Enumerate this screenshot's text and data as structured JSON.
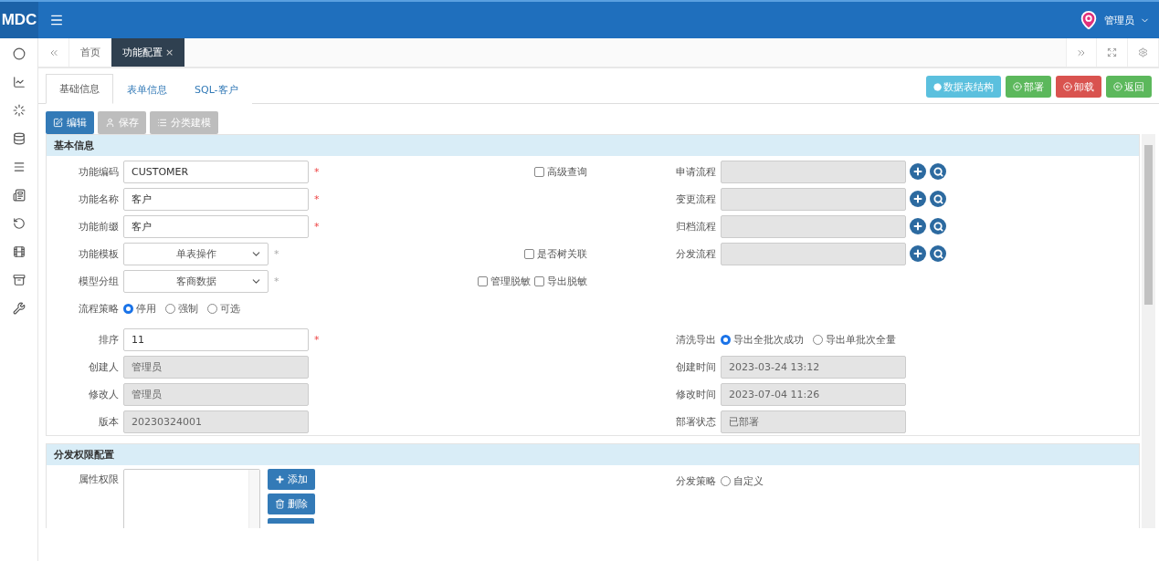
{
  "header": {
    "logo": "MDC",
    "user": "管理员"
  },
  "page_tabs": [
    {
      "label": "首页",
      "selected": false,
      "closable": false
    },
    {
      "label": "功能配置",
      "selected": true,
      "closable": true
    }
  ],
  "close_mark": "×",
  "sub_tabs": [
    {
      "label": "基础信息",
      "selected": true
    },
    {
      "label": "表单信息",
      "selected": false
    },
    {
      "label": "SQL-客户",
      "selected": false
    }
  ],
  "actions": [
    {
      "label": "数据表结构",
      "color": "#5bc0de"
    },
    {
      "label": "部署",
      "color": "#5cb85c"
    },
    {
      "label": "卸载",
      "color": "#d9534f"
    },
    {
      "label": "返回",
      "color": "#5cb85c"
    }
  ],
  "toolbar": [
    {
      "label": "编辑",
      "disabled": false
    },
    {
      "label": "保存",
      "disabled": true
    },
    {
      "label": "分类建模",
      "disabled": true
    }
  ],
  "basic_section": {
    "title": "基本信息",
    "rows": [
      {
        "left": {
          "label": "功能编码",
          "kind": "text",
          "value": "CUSTOMER",
          "required": true,
          "disabled": false
        },
        "checks": [
          {
            "label": "高级查询",
            "checked": false
          }
        ],
        "right": {
          "label": "申请流程",
          "kind": "lookup",
          "disabled": true
        }
      },
      {
        "left": {
          "label": "功能名称",
          "kind": "text",
          "value": "客户",
          "required": true,
          "disabled": false
        },
        "checks": [],
        "right": {
          "label": "变更流程",
          "kind": "lookup",
          "disabled": true
        }
      },
      {
        "left": {
          "label": "功能前缀",
          "kind": "text",
          "value": "客户",
          "required": true,
          "disabled": false
        },
        "checks": [],
        "right": {
          "label": "归档流程",
          "kind": "lookup",
          "disabled": true
        }
      },
      {
        "left": {
          "label": "功能模板",
          "kind": "select",
          "value": "单表操作",
          "required": true,
          "disabled": false
        },
        "checks": [
          {
            "label": "是否树关联",
            "checked": false
          }
        ],
        "right": {
          "label": "分发流程",
          "kind": "lookup",
          "disabled": true
        }
      },
      {
        "left": {
          "label": "模型分组",
          "kind": "select",
          "value": "客商数据",
          "required": true,
          "disabled": false
        },
        "checks": [
          {
            "label": "管理脱敏",
            "checked": false
          },
          {
            "label": "导出脱敏",
            "checked": false
          }
        ]
      },
      {
        "left": {
          "label": "流程策略",
          "kind": "radio",
          "options": [
            {
              "label": "停用",
              "selected": true
            },
            {
              "label": "强制",
              "selected": false
            },
            {
              "label": "可选",
              "selected": false
            }
          ]
        },
        "checks": []
      },
      {
        "left": {
          "label": "排序",
          "kind": "text",
          "value": "11",
          "required": true,
          "disabled": false
        },
        "checks": [],
        "right": {
          "label": "清洗导出",
          "kind": "radio",
          "options": [
            {
              "label": "导出全批次成功",
              "selected": true
            },
            {
              "label": "导出单批次全量",
              "selected": false
            }
          ]
        }
      },
      {
        "left": {
          "label": "创建人",
          "kind": "text",
          "value": "管理员",
          "required": false,
          "disabled": true
        },
        "checks": [],
        "right": {
          "label": "创建时间",
          "kind": "text",
          "value": "2023-03-24 13:12",
          "required": false,
          "disabled": true
        }
      },
      {
        "left": {
          "label": "修改人",
          "kind": "text",
          "value": "管理员",
          "required": false,
          "disabled": true
        },
        "checks": [],
        "right": {
          "label": "修改时间",
          "kind": "text",
          "value": "2023-07-04 11:26",
          "required": false,
          "disabled": true
        }
      },
      {
        "left": {
          "label": "版本",
          "kind": "text",
          "value": "20230324001",
          "required": false,
          "disabled": true
        },
        "checks": [],
        "right": {
          "label": "部署状态",
          "kind": "text",
          "value": "已部署",
          "required": false,
          "disabled": true
        }
      }
    ]
  },
  "dist_section": {
    "title": "分发权限配置",
    "attr_label": "属性权限",
    "buttons": [
      {
        "label": "添加"
      },
      {
        "label": "删除"
      }
    ],
    "strategy": {
      "label": "分发策略",
      "options": [
        {
          "label": "自定义",
          "selected": false
        }
      ]
    }
  },
  "required_mark": "*"
}
